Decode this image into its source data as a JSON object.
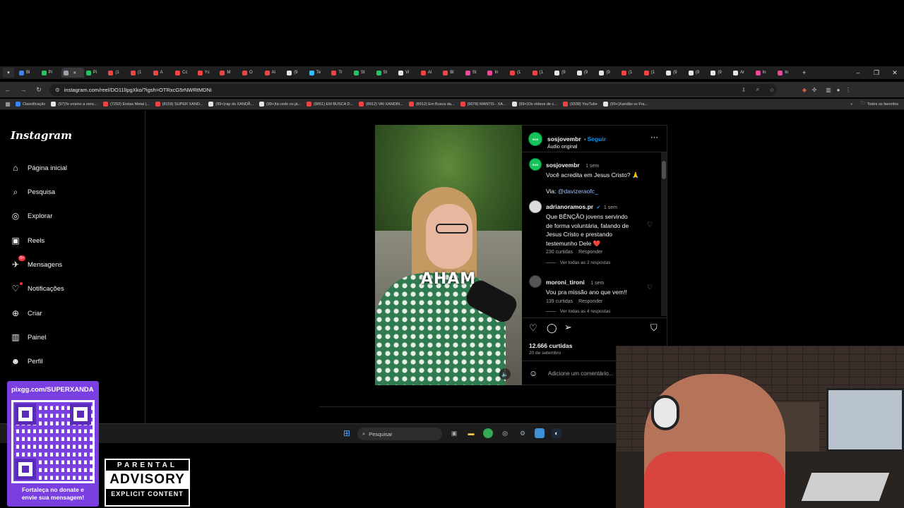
{
  "browser": {
    "tabs": [
      {
        "label": "Bl",
        "color": "#3b82f6"
      },
      {
        "label": "Pi",
        "color": "#22c55e"
      },
      {
        "label": "",
        "color": "#9ca3af",
        "active": true
      },
      {
        "label": "Pi",
        "color": "#22c55e"
      },
      {
        "label": "(1",
        "color": "#ef4444"
      },
      {
        "label": "(1",
        "color": "#ef4444"
      },
      {
        "label": "A",
        "color": "#ef4444"
      },
      {
        "label": "Cc",
        "color": "#ef4444"
      },
      {
        "label": "Yc",
        "color": "#ef4444"
      },
      {
        "label": "M",
        "color": "#ef4444"
      },
      {
        "label": "O",
        "color": "#ef4444"
      },
      {
        "label": "Al",
        "color": "#ef4444"
      },
      {
        "label": "(9",
        "color": "#e5e5e5"
      },
      {
        "label": "Te",
        "color": "#38bdf8"
      },
      {
        "label": "Tr",
        "color": "#ef4444"
      },
      {
        "label": "St",
        "color": "#22c55e"
      },
      {
        "label": "St",
        "color": "#22c55e"
      },
      {
        "label": "Vi",
        "color": "#e5e5e5"
      },
      {
        "label": "Al",
        "color": "#ef4444"
      },
      {
        "label": "Bl",
        "color": "#ef4444"
      },
      {
        "label": "St",
        "color": "#ec4899"
      },
      {
        "label": "In",
        "color": "#ec4899"
      },
      {
        "label": "(1",
        "color": "#ef4444"
      },
      {
        "label": "(1",
        "color": "#ef4444"
      },
      {
        "label": "(9",
        "color": "#e5e5e5"
      },
      {
        "label": "(9",
        "color": "#e5e5e5"
      },
      {
        "label": "(9",
        "color": "#e5e5e5"
      },
      {
        "label": "(1",
        "color": "#ef4444"
      },
      {
        "label": "(1",
        "color": "#ef4444"
      },
      {
        "label": "(9",
        "color": "#e5e5e5"
      },
      {
        "label": "(9",
        "color": "#e5e5e5"
      },
      {
        "label": "(9",
        "color": "#e5e5e5"
      },
      {
        "label": "Ar",
        "color": "#e5e5e5"
      },
      {
        "label": "In",
        "color": "#ec4899"
      },
      {
        "label": "In",
        "color": "#ec4899"
      }
    ],
    "url": "instagram.com/reel/DO11lIpgXko/?igsh=OTRxcG5rNWRtMDNi",
    "bookmarks": [
      {
        "label": "Classificação",
        "color": "#3b82f6"
      },
      {
        "label": "(97)Te ensino a venc...",
        "color": "#e5e5e5"
      },
      {
        "label": "(7292) Enéas Metal |...",
        "color": "#ef4444"
      },
      {
        "label": "(8159) SUPER XAND...",
        "color": "#ef4444"
      },
      {
        "label": "(99+)rap do XANDÃ...",
        "color": "#e5e5e5"
      },
      {
        "label": "(99+)tá cedo ou já...",
        "color": "#e5e5e5"
      },
      {
        "label": "(8851) EM BUSCA D...",
        "color": "#ef4444"
      },
      {
        "label": "(8912) VAI XANDIN...",
        "color": "#ef4444"
      },
      {
        "label": "(8912) Em Busca da...",
        "color": "#ef4444"
      },
      {
        "label": "(9078) MANTIS - XA...",
        "color": "#ef4444"
      },
      {
        "label": "(99+)Os vídeos de c...",
        "color": "#e5e5e5"
      },
      {
        "label": "(9338) YouTube",
        "color": "#ef4444"
      },
      {
        "label": "(99+)Xandão vs Fra...",
        "color": "#e5e5e5"
      }
    ],
    "all_bookmarks": "Todos os favoritos"
  },
  "sidebar": {
    "logo": "Instagram",
    "items": [
      {
        "label": "Página inicial",
        "icon": "home-icon"
      },
      {
        "label": "Pesquisa",
        "icon": "search-icon"
      },
      {
        "label": "Explorar",
        "icon": "compass-icon"
      },
      {
        "label": "Reels",
        "icon": "reels-icon"
      },
      {
        "label": "Mensagens",
        "icon": "messenger-icon",
        "badge": "9+"
      },
      {
        "label": "Notificações",
        "icon": "heart-icon"
      },
      {
        "label": "Criar",
        "icon": "plus-icon"
      },
      {
        "label": "Painel",
        "icon": "dashboard-icon"
      },
      {
        "label": "Perfil",
        "icon": "profile-icon"
      }
    ]
  },
  "reel": {
    "caption_overlay": "AHAM",
    "owner": "sosjovembr",
    "follow": "Seguir",
    "audio": "Áudio original",
    "post": {
      "user": "sosjovembr",
      "time": "1 sem",
      "text": "Você acredita em Jesus Cristo? 🙏",
      "via_label": "Via:",
      "via_link": "@davizeraofc_"
    },
    "comments": [
      {
        "user": "adrianoramos.pr",
        "time": "1 sem",
        "lines": [
          "Que BÊNÇÃO jovens servindo",
          "de forma voluntária, falando de",
          "Jesus Cristo e prestando",
          "testemunho Dele ❤️"
        ],
        "likes": "230 curtidas",
        "reply": "Responder",
        "view_replies": "Ver todas as 2 respostas"
      },
      {
        "user": "moroni_tironi",
        "time": "1 sem",
        "lines": [
          "Vou pra missão ano que vem!!"
        ],
        "likes": "139 curtidas",
        "reply": "Responder",
        "view_replies": "Ver todas as 4 respostas"
      }
    ],
    "likes": "12.666 curtidas",
    "date": "20 de setembro",
    "add_comment_placeholder": "Adicione um comentário..."
  },
  "taskbar": {
    "search_placeholder": "Pesquisar"
  },
  "overlay": {
    "qr_url": "pixgg.com/SUPERXANDA",
    "qr_message_line1": "Fortaleça no donate e",
    "qr_message_line2": "envie sua mensagem!",
    "advisory_top": "PARENTAL",
    "advisory_mid": "ADVISORY",
    "advisory_bottom": "EXPLICIT CONTENT"
  }
}
